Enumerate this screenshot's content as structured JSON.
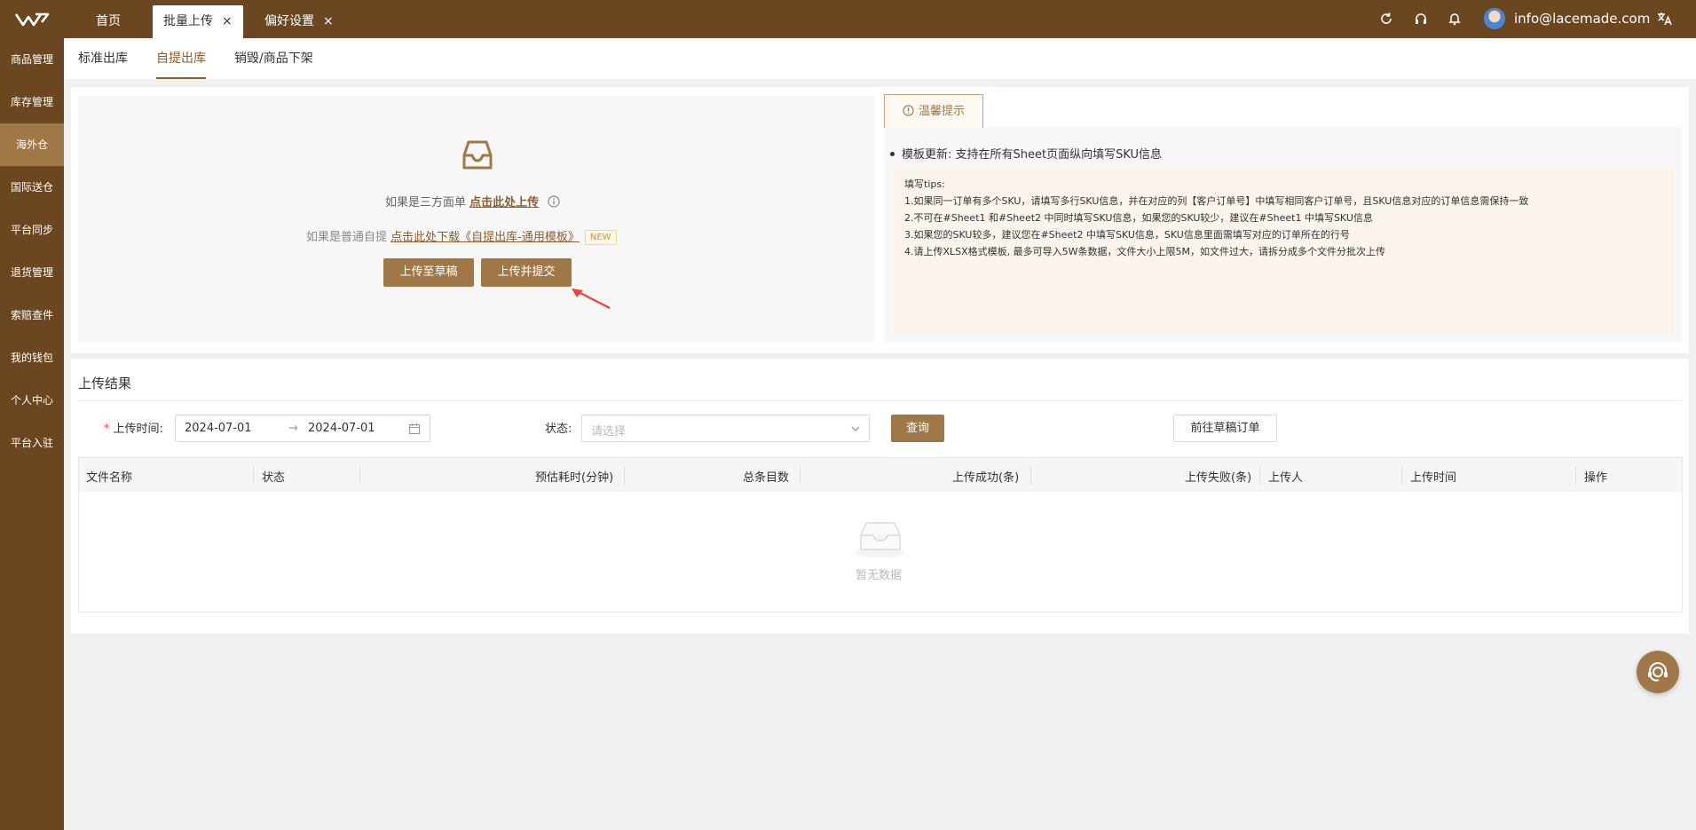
{
  "colors": {
    "brand": "#6b4721",
    "accent": "#a07848",
    "active_text": "#8b5e30"
  },
  "topbar": {
    "tabs": [
      {
        "label": "首页",
        "closable": false
      },
      {
        "label": "批量上传",
        "closable": true,
        "active": true
      },
      {
        "label": "偏好设置",
        "closable": true
      }
    ],
    "close_glyph": "×",
    "icons": [
      "refresh-icon",
      "headset-icon",
      "bell-icon",
      "translate-icon"
    ],
    "user_email": "info@lacemade.com"
  },
  "sidebar": {
    "items": [
      {
        "label": "商品管理"
      },
      {
        "label": "库存管理"
      },
      {
        "label": "海外仓",
        "active": true
      },
      {
        "label": "国际送仓"
      },
      {
        "label": "平台同步"
      },
      {
        "label": "退货管理"
      },
      {
        "label": "索赔查件"
      },
      {
        "label": "我的钱包"
      },
      {
        "label": "个人中心"
      },
      {
        "label": "平台入驻"
      }
    ]
  },
  "subnav": {
    "tabs": [
      {
        "label": "标准出库"
      },
      {
        "label": "自提出库",
        "active": true
      },
      {
        "label": "销毁/商品下架"
      }
    ]
  },
  "upload": {
    "line1_prefix": "如果是三方面单 ",
    "line1_link": "点击此处上传",
    "line2_prefix": "如果是普通自提 ",
    "line2_link": "点击此处下载《自提出库-通用模板》",
    "new_badge": "NEW",
    "btn_draft": "上传至草稿",
    "btn_submit": "上传并提交"
  },
  "tips": {
    "tab_label": "温馨提示",
    "bullet": "模板更新: 支持在所有Sheet页面纵向填写SKU信息",
    "heading": "填写tips:",
    "lines": [
      "1.如果同一订单有多个SKU，请填写多行SKU信息，并在对应的列【客户订单号】中填写相同客户订单号，且SKU信息对应的订单信息需保持一致",
      "2.不可在#Sheet1 和#Sheet2 中同时填写SKU信息，如果您的SKU较少，建议在#Sheet1 中填写SKU信息",
      "3.如果您的SKU较多，建议您在#Sheet2 中填写SKU信息，SKU信息里面需填写对应的订单所在的行号",
      "4.请上传XLSX格式模板, 最多可导入5W条数据，文件大小上限5M，如文件过大，请拆分成多个文件分批次上传"
    ]
  },
  "results": {
    "title": "上传结果",
    "filter": {
      "time_label": "上传时间:",
      "required_mark": "*",
      "date_start": "2024-07-01",
      "date_sep": "→",
      "date_end": "2024-07-01",
      "status_label": "状态:",
      "status_placeholder": "请选择",
      "query_btn": "查询",
      "draft_btn": "前往草稿订单"
    },
    "columns": [
      "文件名称",
      "状态",
      "预估耗时(分钟)",
      "总条目数",
      "上传成功(条)",
      "上传失败(条)",
      "上传人",
      "上传时间",
      "操作"
    ],
    "rows": [],
    "empty_text": "暂无数据"
  }
}
